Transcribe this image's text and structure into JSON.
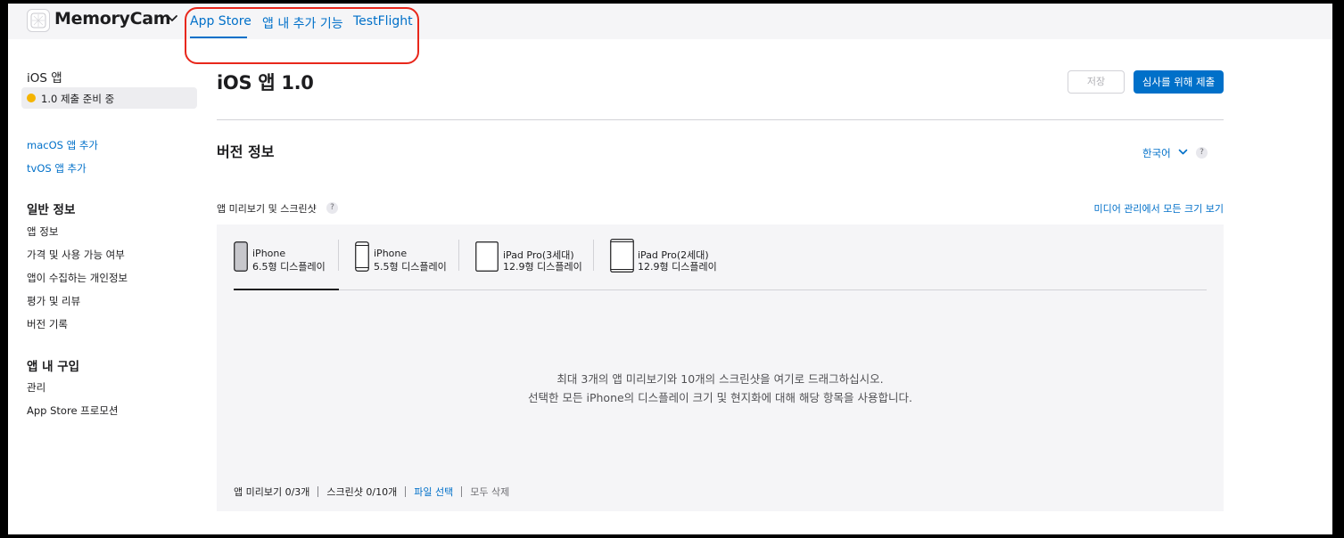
{
  "topbar": {
    "app_name": "MemoryCam",
    "tabs": [
      {
        "label": "App Store",
        "active": true
      },
      {
        "label": "앱 내 추가 기능",
        "active": false
      },
      {
        "label": "TestFlight",
        "active": false
      }
    ]
  },
  "sidebar": {
    "ios_section": "iOS 앱",
    "ios_version": "1.0 제출 준비 중",
    "add_links": [
      "macOS 앱 추가",
      "tvOS 앱 추가"
    ],
    "general_section": "일반 정보",
    "general_items": [
      "앱 정보",
      "가격 및 사용 가능 여부",
      "앱이 수집하는 개인정보",
      "평가 및 리뷰",
      "버전 기록"
    ],
    "iap_section": "앱 내 구입",
    "iap_items": [
      "관리",
      "App Store 프로모션"
    ]
  },
  "main": {
    "page_title": "iOS 앱 1.0",
    "save_label": "저장",
    "submit_label": "심사를 위해 제출",
    "section_title": "버전 정보",
    "language": "한국어",
    "help": "?",
    "media_label": "앱 미리보기 및 스크린샷",
    "media_link": "미디어 관리에서 모든 크기 보기",
    "devices": [
      {
        "name": "iPhone",
        "size": "6.5형 디스플레이",
        "active": true
      },
      {
        "name": "iPhone",
        "size": "5.5형 디스플레이",
        "active": false
      },
      {
        "name": "iPad Pro(3세대)",
        "size": "12.9형 디스플레이",
        "active": false
      },
      {
        "name": "iPad Pro(2세대)",
        "size": "12.9형 디스플레이",
        "active": false
      }
    ],
    "drop_text_1": "최대 3개의 앱 미리보기와 10개의 스크린샷을 여기로 드래그하십시오.",
    "drop_text_2": "선택한 모든 iPhone의 디스플레이 크기 및 현지화에 대해 해당 항목을 사용합니다.",
    "footer": {
      "previews": "앱 미리보기 0/3개",
      "screenshots": "스크린샷 0/10개",
      "choose_file": "파일 선택",
      "delete_all": "모두 삭제"
    }
  },
  "colors": {
    "accent": "#0070c9",
    "highlight_ring": "#e8271b",
    "status_dot": "#f5b400"
  }
}
